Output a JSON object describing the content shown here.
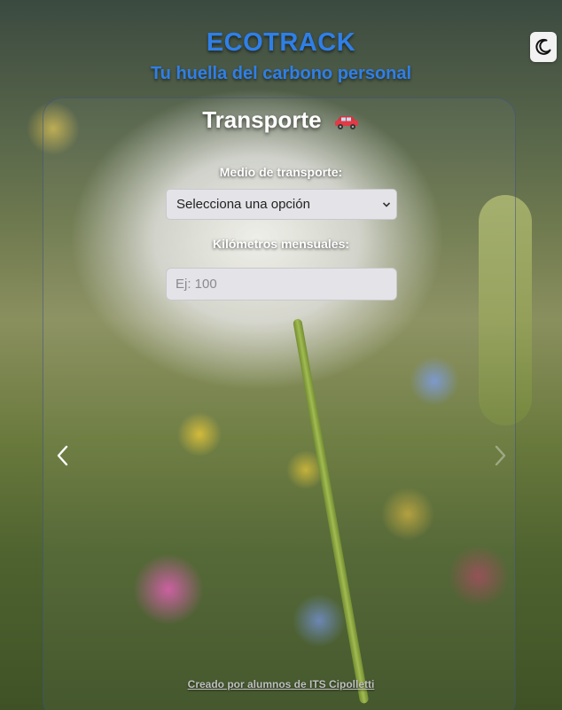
{
  "header": {
    "brand": "ECOTRACK",
    "tagline": "Tu huella del carbono personal"
  },
  "section": {
    "title": "Transporte",
    "icon": "car-icon"
  },
  "form": {
    "transport_label": "Medio de transporte:",
    "transport_select_value": "Selecciona una opción",
    "km_label": "Kilómetros mensuales:",
    "km_placeholder": "Ej: 100",
    "km_value": ""
  },
  "controls": {
    "theme_toggle_icon": "moon-icon",
    "prev_icon": "chevron-left-icon",
    "next_icon": "chevron-right-icon"
  },
  "footer": {
    "credit": "Creado por alumnos de ITS Cipolletti"
  },
  "colors": {
    "brand": "#2f7fe8",
    "title": "#ffffff",
    "field_bg": "#e4e4e8"
  }
}
